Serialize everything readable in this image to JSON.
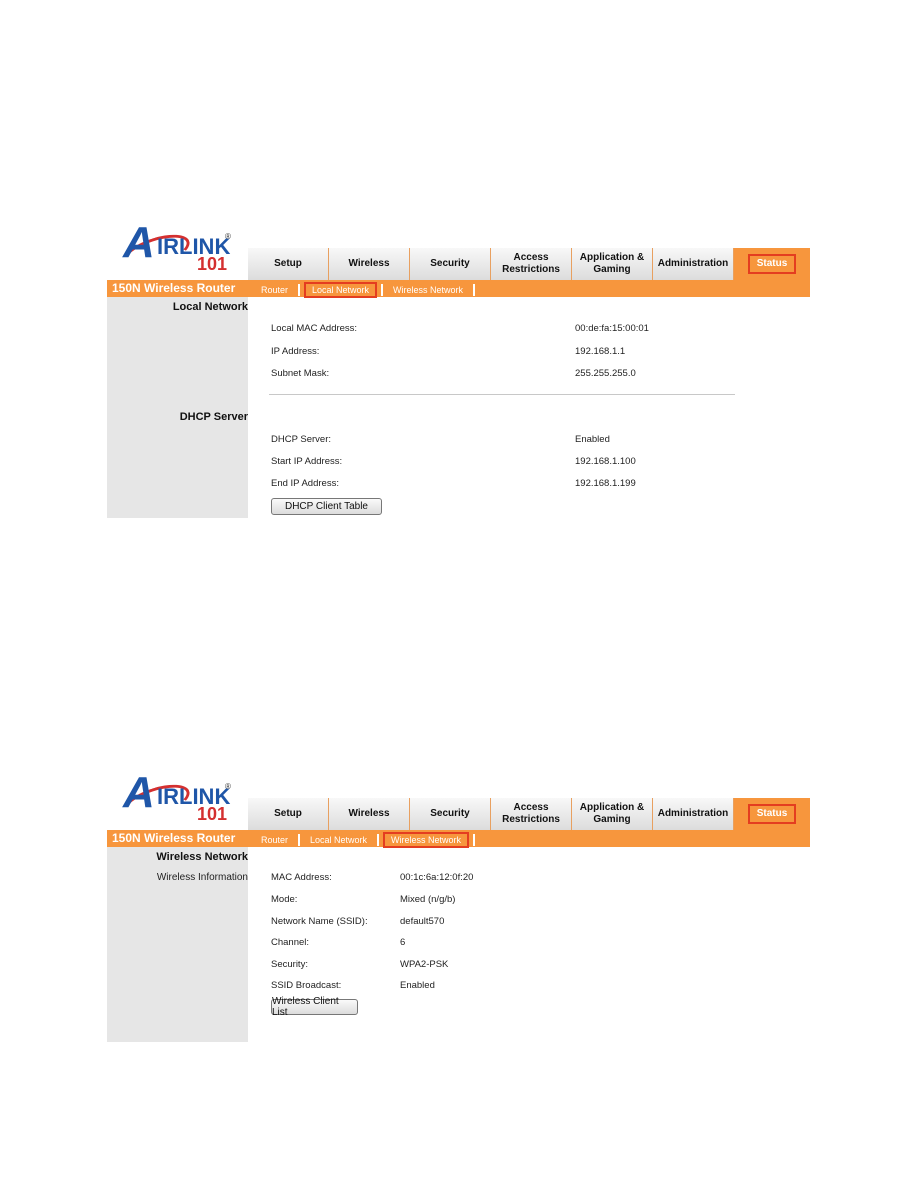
{
  "screens": [
    {
      "logo": {
        "brand": "IRLINK",
        "initial": "A",
        "number": "101",
        "registered": "®"
      },
      "nav_tabs": [
        "Setup",
        "Wireless",
        "Security",
        "Access Restrictions",
        "Application & Gaming",
        "Administration",
        "Status"
      ],
      "active_tab": "Status",
      "product": "150N Wireless Router",
      "sub_tabs": [
        "Router",
        "Local Network",
        "Wireless Network"
      ],
      "active_sub_tab": "Local Network",
      "section1": {
        "heading": "Local Network",
        "rows": [
          {
            "label": "Local MAC Address:",
            "value": "00:de:fa:15:00:01"
          },
          {
            "label": "IP Address:",
            "value": "192.168.1.1"
          },
          {
            "label": "Subnet Mask:",
            "value": "255.255.255.0"
          }
        ]
      },
      "section2": {
        "heading": "DHCP Server",
        "rows": [
          {
            "label": "DHCP Server:",
            "value": "Enabled"
          },
          {
            "label": "Start IP Address:",
            "value": "192.168.1.100"
          },
          {
            "label": "End IP Address:",
            "value": "192.168.1.199"
          }
        ],
        "button": "DHCP Client Table"
      }
    },
    {
      "logo": {
        "brand": "IRLINK",
        "initial": "A",
        "number": "101",
        "registered": "®"
      },
      "nav_tabs": [
        "Setup",
        "Wireless",
        "Security",
        "Access Restrictions",
        "Application & Gaming",
        "Administration",
        "Status"
      ],
      "active_tab": "Status",
      "product": "150N Wireless Router",
      "sub_tabs": [
        "Router",
        "Local Network",
        "Wireless Network"
      ],
      "active_sub_tab": "Wireless Network",
      "section1": {
        "heading": "Wireless Network",
        "subheading": "Wireless Information",
        "rows": [
          {
            "label": "MAC Address:",
            "value": "00:1c:6a:12:0f:20"
          },
          {
            "label": "Mode:",
            "value": "Mixed (n/g/b)"
          },
          {
            "label": "Network Name (SSID):",
            "value": "default570"
          },
          {
            "label": "Channel:",
            "value": "6"
          },
          {
            "label": "Security:",
            "value": "WPA2-PSK"
          },
          {
            "label": "SSID Broadcast:",
            "value": "Enabled"
          }
        ],
        "button": "Wireless Client List"
      }
    }
  ],
  "colors": {
    "accent": "#f7963d",
    "highlight_border": "#e43d20",
    "sidebar": "#e6e6e6",
    "logo_blue": "#1f56a8",
    "logo_red": "#d43030"
  }
}
